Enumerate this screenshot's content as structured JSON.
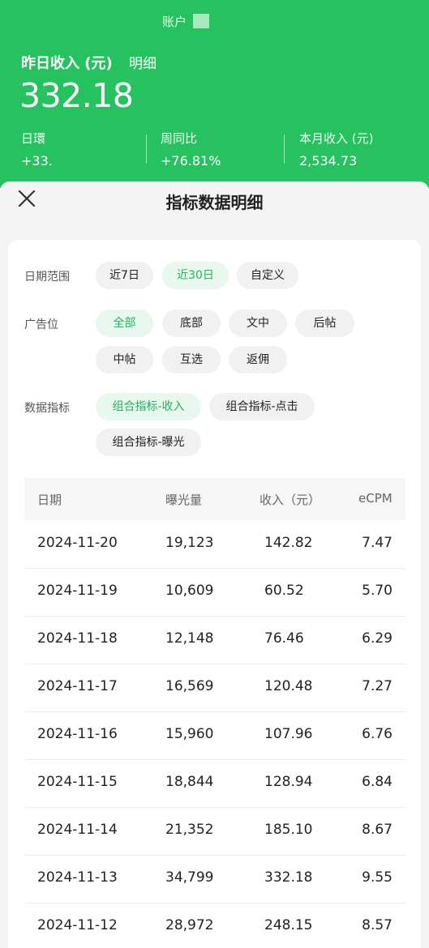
{
  "header": {
    "account_label": "账户",
    "income_title": "昨日收入 (元)",
    "detail_link": "明细",
    "amount": "332.18",
    "stats": [
      {
        "label": "日環",
        "value": "+33."
      },
      {
        "label": "周同比",
        "value": "+76.81%"
      },
      {
        "label": "本月收入 (元)",
        "value": "2,534.73"
      }
    ]
  },
  "sheet": {
    "title": "指标数据明细",
    "close_icon": "close-icon"
  },
  "filters": {
    "date_range": {
      "label": "日期范围",
      "options": [
        "近7日",
        "近30日",
        "自定义"
      ],
      "selected": "近30日"
    },
    "ad_position": {
      "label": "广告位",
      "options": [
        "全部",
        "底部",
        "文中",
        "后帖",
        "中帖",
        "互选",
        "返佣"
      ],
      "selected": "全部"
    },
    "metric": {
      "label": "数据指标",
      "options": [
        "组合指标-收入",
        "组合指标-点击",
        "组合指标-曝光"
      ],
      "selected": "组合指标-收入"
    }
  },
  "table": {
    "headers": [
      "日期",
      "曝光量",
      "收入（元）",
      "eCPM"
    ],
    "rows": [
      {
        "date": "2024-11-20",
        "exposure": "19,123",
        "income": "142.82",
        "ecpm": "7.47"
      },
      {
        "date": "2024-11-19",
        "exposure": "10,609",
        "income": "60.52",
        "ecpm": "5.70"
      },
      {
        "date": "2024-11-18",
        "exposure": "12,148",
        "income": "76.46",
        "ecpm": "6.29"
      },
      {
        "date": "2024-11-17",
        "exposure": "16,569",
        "income": "120.48",
        "ecpm": "7.27"
      },
      {
        "date": "2024-11-16",
        "exposure": "15,960",
        "income": "107.96",
        "ecpm": "6.76"
      },
      {
        "date": "2024-11-15",
        "exposure": "18,844",
        "income": "128.94",
        "ecpm": "6.84"
      },
      {
        "date": "2024-11-14",
        "exposure": "21,352",
        "income": "185.10",
        "ecpm": "8.67"
      },
      {
        "date": "2024-11-13",
        "exposure": "34,799",
        "income": "332.18",
        "ecpm": "9.55"
      },
      {
        "date": "2024-11-12",
        "exposure": "28,972",
        "income": "248.15",
        "ecpm": "8.57"
      }
    ]
  },
  "colors": {
    "brand_green": "#26c25f",
    "active_chip_text": "#22b45a",
    "active_chip_bg": "#e8f8ee"
  }
}
